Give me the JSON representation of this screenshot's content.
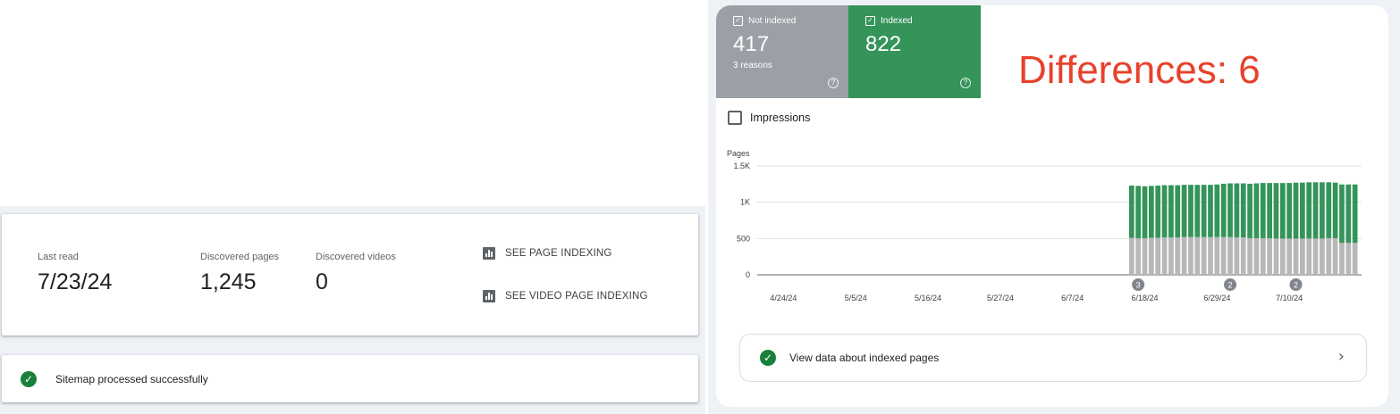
{
  "sitemap": {
    "last_read_label": "Last read",
    "last_read_value": "7/23/24",
    "pages_label": "Discovered pages",
    "pages_value": "1,245",
    "videos_label": "Discovered videos",
    "videos_value": "0",
    "link_page_indexing": "SEE PAGE INDEXING",
    "link_video_indexing": "SEE VIDEO PAGE INDEXING",
    "status_text": "Sitemap processed successfully"
  },
  "indexing": {
    "not_indexed": {
      "label": "Not indexed",
      "count": "417",
      "sub": "3 reasons",
      "color": "#9aa0a6"
    },
    "indexed": {
      "label": "Indexed",
      "count": "822",
      "color": "#34945a"
    },
    "impressions_label": "Impressions",
    "view_data_label": "View data about indexed pages"
  },
  "overlay": {
    "differences_text": "Differences: 6",
    "color": "#e8412c"
  },
  "chart_data": {
    "type": "bar",
    "stacked": true,
    "ylabel": "Pages",
    "y_ticks": [
      "1.5K",
      "1K",
      "500",
      "0"
    ],
    "ylim": [
      0,
      1500
    ],
    "x_ticks": [
      "4/24/24",
      "5/5/24",
      "5/16/24",
      "5/27/24",
      "6/7/24",
      "6/18/24",
      "6/29/24",
      "7/10/24"
    ],
    "x_range_days": [
      "4/20/24",
      "7/21/24"
    ],
    "bars_start_date": "6/16/24",
    "series": [
      {
        "name": "Not indexed",
        "color": "#b8b8b8",
        "values": [
          510,
          505,
          505,
          510,
          510,
          515,
          515,
          515,
          520,
          520,
          520,
          520,
          520,
          520,
          520,
          520,
          515,
          515,
          505,
          505,
          505,
          505,
          500,
          500,
          500,
          500,
          500,
          500,
          500,
          500,
          505,
          505,
          440,
          440,
          440
        ]
      },
      {
        "name": "Indexed",
        "color": "#34945a",
        "values": [
          720,
          720,
          715,
          715,
          720,
          720,
          720,
          720,
          720,
          720,
          720,
          720,
          720,
          725,
          735,
          740,
          745,
          745,
          750,
          755,
          760,
          760,
          765,
          765,
          765,
          770,
          770,
          775,
          775,
          775,
          770,
          765,
          805,
          805,
          805
        ]
      }
    ],
    "annotations": [
      {
        "date": "6/17/24",
        "label": "3"
      },
      {
        "date": "7/1/24",
        "label": "2"
      },
      {
        "date": "7/11/24",
        "label": "2"
      }
    ],
    "grid": true
  }
}
